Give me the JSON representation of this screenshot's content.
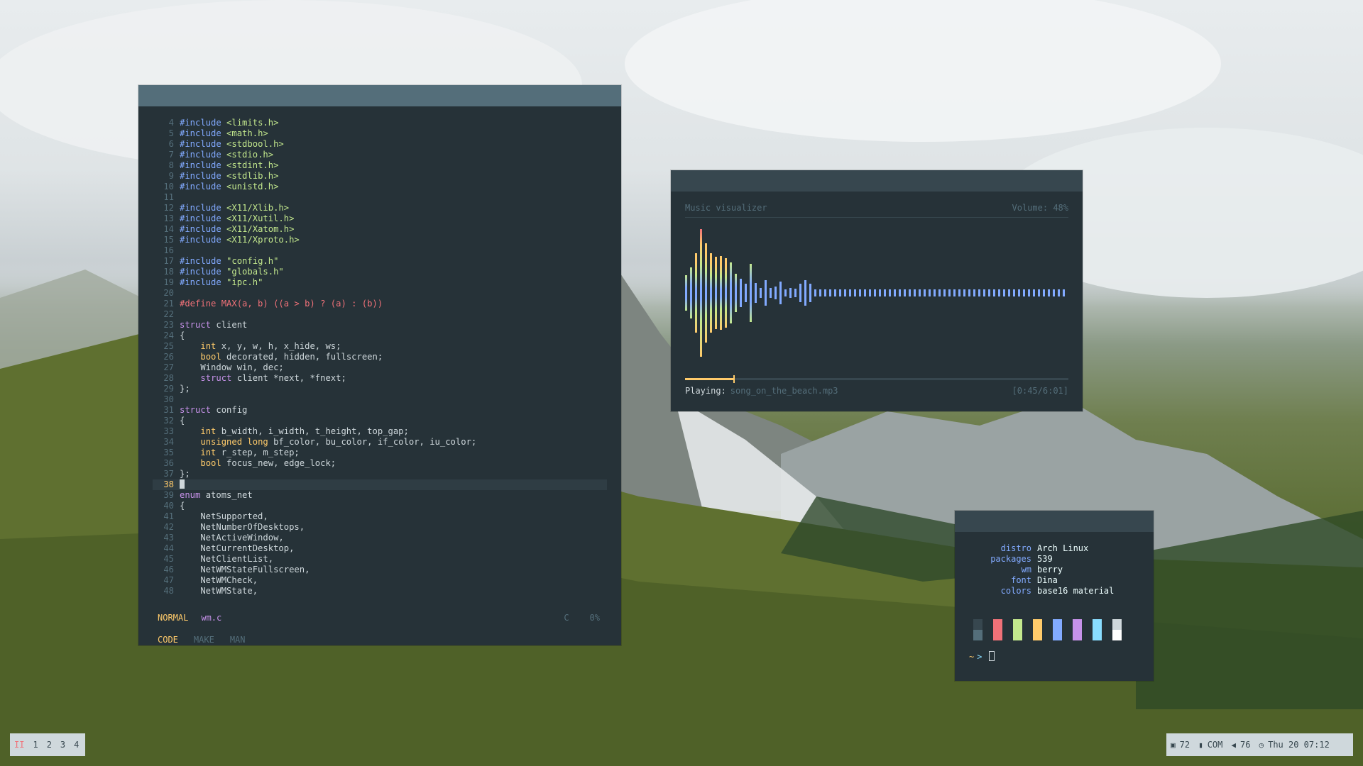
{
  "editor": {
    "lines": [
      {
        "n": "4",
        "parts": [
          [
            "c-inc",
            "#include "
          ],
          [
            "c-str",
            "<limits.h>"
          ]
        ]
      },
      {
        "n": "5",
        "parts": [
          [
            "c-inc",
            "#include "
          ],
          [
            "c-str",
            "<math.h>"
          ]
        ]
      },
      {
        "n": "6",
        "parts": [
          [
            "c-inc",
            "#include "
          ],
          [
            "c-str",
            "<stdbool.h>"
          ]
        ]
      },
      {
        "n": "7",
        "parts": [
          [
            "c-inc",
            "#include "
          ],
          [
            "c-str",
            "<stdio.h>"
          ]
        ]
      },
      {
        "n": "8",
        "parts": [
          [
            "c-inc",
            "#include "
          ],
          [
            "c-str",
            "<stdint.h>"
          ]
        ]
      },
      {
        "n": "9",
        "parts": [
          [
            "c-inc",
            "#include "
          ],
          [
            "c-str",
            "<stdlib.h>"
          ]
        ]
      },
      {
        "n": "10",
        "parts": [
          [
            "c-inc",
            "#include "
          ],
          [
            "c-str",
            "<unistd.h>"
          ]
        ]
      },
      {
        "n": "11",
        "parts": []
      },
      {
        "n": "12",
        "parts": [
          [
            "c-inc",
            "#include "
          ],
          [
            "c-str",
            "<X11/Xlib.h>"
          ]
        ]
      },
      {
        "n": "13",
        "parts": [
          [
            "c-inc",
            "#include "
          ],
          [
            "c-str",
            "<X11/Xutil.h>"
          ]
        ]
      },
      {
        "n": "14",
        "parts": [
          [
            "c-inc",
            "#include "
          ],
          [
            "c-str",
            "<X11/Xatom.h>"
          ]
        ]
      },
      {
        "n": "15",
        "parts": [
          [
            "c-inc",
            "#include "
          ],
          [
            "c-str",
            "<X11/Xproto.h>"
          ]
        ]
      },
      {
        "n": "16",
        "parts": []
      },
      {
        "n": "17",
        "parts": [
          [
            "c-inc",
            "#include "
          ],
          [
            "c-str",
            "\"config.h\""
          ]
        ]
      },
      {
        "n": "18",
        "parts": [
          [
            "c-inc",
            "#include "
          ],
          [
            "c-str",
            "\"globals.h\""
          ]
        ]
      },
      {
        "n": "19",
        "parts": [
          [
            "c-inc",
            "#include "
          ],
          [
            "c-str",
            "\"ipc.h\""
          ]
        ]
      },
      {
        "n": "20",
        "parts": []
      },
      {
        "n": "21",
        "parts": [
          [
            "c-def",
            "#define MAX(a, b) ((a > b) ? (a) : (b))"
          ]
        ]
      },
      {
        "n": "22",
        "parts": []
      },
      {
        "n": "23",
        "parts": [
          [
            "c-kw",
            "struct"
          ],
          [
            "",
            "client"
          ]
        ]
      },
      {
        "n": "24",
        "parts": [
          [
            "",
            "{"
          ]
        ]
      },
      {
        "n": "25",
        "parts": [
          [
            "",
            "    "
          ],
          [
            "c-type",
            "int"
          ],
          [
            "",
            " x, y, w, h, x_hide, ws;"
          ]
        ]
      },
      {
        "n": "26",
        "parts": [
          [
            "",
            "    "
          ],
          [
            "c-type",
            "bool"
          ],
          [
            "",
            " decorated, hidden, fullscreen;"
          ]
        ]
      },
      {
        "n": "27",
        "parts": [
          [
            "",
            "    Window win, dec;"
          ]
        ]
      },
      {
        "n": "28",
        "parts": [
          [
            "",
            "    "
          ],
          [
            "c-kw",
            "struct"
          ],
          [
            "",
            " client *next, *fnext;"
          ]
        ]
      },
      {
        "n": "29",
        "parts": [
          [
            "",
            "};"
          ]
        ]
      },
      {
        "n": "30",
        "parts": []
      },
      {
        "n": "31",
        "parts": [
          [
            "c-kw",
            "struct"
          ],
          [
            "",
            " config"
          ]
        ]
      },
      {
        "n": "32",
        "parts": [
          [
            "",
            "{"
          ]
        ]
      },
      {
        "n": "33",
        "parts": [
          [
            "",
            "    "
          ],
          [
            "c-type",
            "int"
          ],
          [
            "",
            " b_width, i_width, t_height, top_gap;"
          ]
        ]
      },
      {
        "n": "34",
        "parts": [
          [
            "",
            "    "
          ],
          [
            "c-type",
            "unsigned long"
          ],
          [
            "",
            " bf_color, bu_color, if_color, iu_color;"
          ]
        ]
      },
      {
        "n": "35",
        "parts": [
          [
            "",
            "    "
          ],
          [
            "c-type",
            "int"
          ],
          [
            "",
            " r_step, m_step;"
          ]
        ]
      },
      {
        "n": "36",
        "parts": [
          [
            "",
            "    "
          ],
          [
            "c-type",
            "bool"
          ],
          [
            "",
            " focus_new, edge_lock;"
          ]
        ]
      },
      {
        "n": "37",
        "parts": [
          [
            "",
            "};"
          ]
        ]
      },
      {
        "n": "38",
        "parts": [],
        "current": true
      },
      {
        "n": "39",
        "parts": [
          [
            "c-kw",
            "enum"
          ],
          [
            "",
            " atoms_net"
          ]
        ]
      },
      {
        "n": "40",
        "parts": [
          [
            "",
            "{"
          ]
        ]
      },
      {
        "n": "41",
        "parts": [
          [
            "",
            "    NetSupported,"
          ]
        ]
      },
      {
        "n": "42",
        "parts": [
          [
            "",
            "    NetNumberOfDesktops,"
          ]
        ]
      },
      {
        "n": "43",
        "parts": [
          [
            "",
            "    NetActiveWindow,"
          ]
        ]
      },
      {
        "n": "44",
        "parts": [
          [
            "",
            "    NetCurrentDesktop,"
          ]
        ]
      },
      {
        "n": "45",
        "parts": [
          [
            "",
            "    NetClientList,"
          ]
        ]
      },
      {
        "n": "46",
        "parts": [
          [
            "",
            "    NetWMStateFullscreen,"
          ]
        ]
      },
      {
        "n": "47",
        "parts": [
          [
            "",
            "    NetWMCheck,"
          ]
        ]
      },
      {
        "n": "48",
        "parts": [
          [
            "",
            "    NetWMState,"
          ]
        ]
      }
    ],
    "status": {
      "mode": "NORMAL",
      "file": "wm.c",
      "filetype": "C",
      "percent": "0%"
    },
    "tabs": [
      {
        "label": "CODE",
        "active": true
      },
      {
        "label": "MAKE",
        "active": false
      },
      {
        "label": "MAN",
        "active": false
      }
    ]
  },
  "visualizer": {
    "title": "Music visualizer",
    "volume": "Volume: 48%",
    "playing_label": "Playing:",
    "song": "song_on_the_beach.mp3",
    "time": "[0:45/6:01]",
    "progress": 0.125,
    "colors": {
      "low": "#82aaff",
      "mid": "#c3e88d",
      "high": "#ffcb6b",
      "peak": "#f07178"
    },
    "amplitudes": [
      0.28,
      0.4,
      0.62,
      1.0,
      0.78,
      0.62,
      0.56,
      0.58,
      0.54,
      0.48,
      0.3,
      0.22,
      0.14,
      0.45,
      0.15,
      0.08,
      0.2,
      0.08,
      0.1,
      0.18,
      0.05,
      0.08,
      0.07,
      0.14,
      0.2,
      0.14,
      0.06,
      0.06,
      0.06,
      0.06,
      0.06,
      0.06,
      0.06,
      0.06,
      0.06,
      0.06,
      0.06,
      0.06,
      0.06,
      0.06,
      0.06,
      0.06,
      0.06,
      0.06,
      0.06,
      0.06,
      0.06,
      0.06,
      0.06,
      0.06,
      0.06,
      0.06,
      0.06,
      0.06,
      0.06,
      0.06,
      0.06,
      0.06,
      0.06,
      0.06,
      0.06,
      0.06,
      0.06,
      0.06,
      0.06,
      0.06,
      0.06,
      0.06,
      0.06,
      0.06,
      0.06,
      0.06,
      0.06,
      0.06,
      0.06,
      0.06,
      0.06
    ]
  },
  "fetch": {
    "rows": [
      {
        "k": "distro",
        "v": "Arch Linux"
      },
      {
        "k": "packages",
        "v": "539"
      },
      {
        "k": "wm",
        "v": "berry"
      },
      {
        "k": "font",
        "v": "Dina"
      },
      {
        "k": "colors",
        "v": "base16 material"
      }
    ],
    "swatches": [
      {
        "top": "#37474f",
        "bottom": "#546e7a"
      },
      {
        "top": "#f07178",
        "bottom": "#f07178"
      },
      {
        "top": "#c3e88d",
        "bottom": "#c3e88d"
      },
      {
        "top": "#ffcb6b",
        "bottom": "#ffcb6b"
      },
      {
        "top": "#82aaff",
        "bottom": "#82aaff"
      },
      {
        "top": "#c792ea",
        "bottom": "#c792ea"
      },
      {
        "top": "#89ddff",
        "bottom": "#89ddff"
      },
      {
        "top": "#cfd8dc",
        "bottom": "#ffffff"
      }
    ],
    "prompt": "~",
    "arrow": ">"
  },
  "panel": {
    "workspaces": [
      "II",
      "1",
      "2",
      "3",
      "4"
    ],
    "active_ws": 0,
    "sys": [
      {
        "icon": "cpu-icon",
        "glyph": "▣",
        "text": "72"
      },
      {
        "icon": "network-icon",
        "glyph": "▮",
        "text": "COM"
      },
      {
        "icon": "volume-icon",
        "glyph": "◀",
        "text": "76"
      },
      {
        "icon": "clock-icon",
        "glyph": "◷",
        "text": "Thu 20 07:12"
      }
    ]
  }
}
